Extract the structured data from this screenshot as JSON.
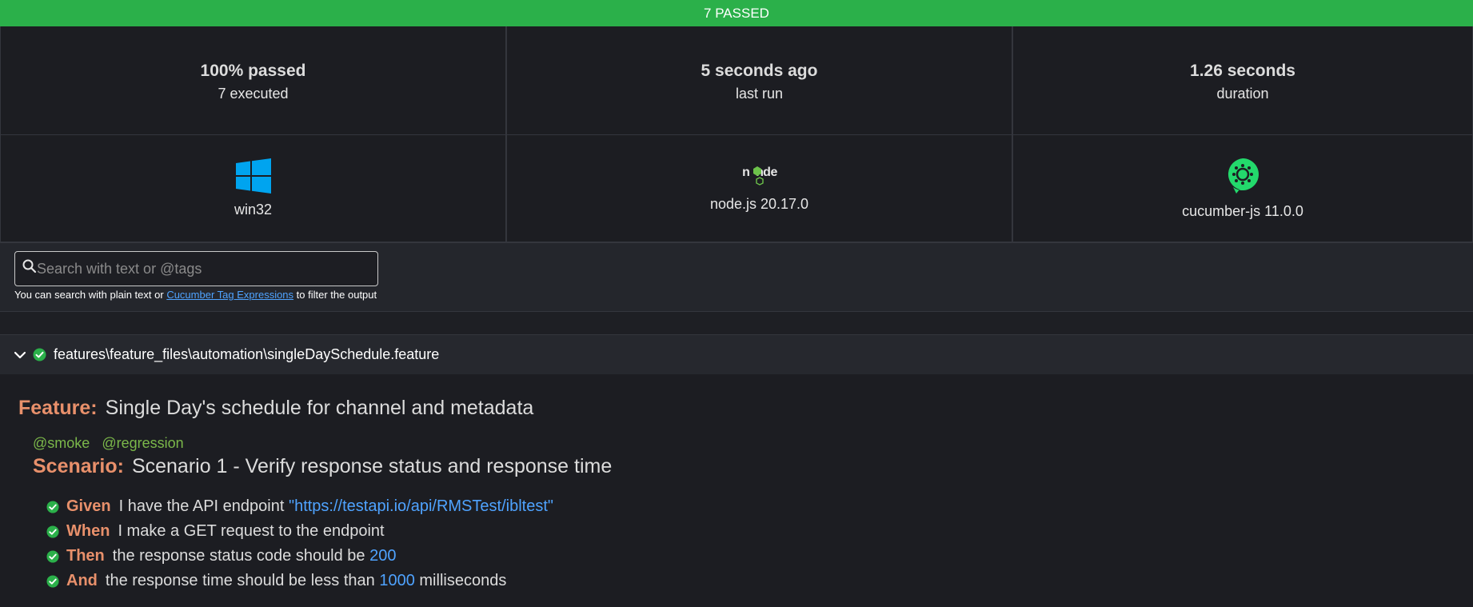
{
  "banner": {
    "text": "7 PASSED",
    "color": "#2bb04a"
  },
  "stats": [
    {
      "value": "100% passed",
      "label": "7 executed"
    },
    {
      "value": "5 seconds ago",
      "label": "last run"
    },
    {
      "value": "1.26 seconds",
      "label": "duration"
    }
  ],
  "env": [
    {
      "icon": "windows-logo-icon",
      "label": "win32"
    },
    {
      "icon": "nodejs-logo-icon",
      "label": "node.js 20.17.0"
    },
    {
      "icon": "cucumber-logo-icon",
      "label": "cucumber-js 11.0.0"
    }
  ],
  "search": {
    "placeholder": "Search with text or @tags",
    "value": "",
    "help_prefix": "You can search with plain text or",
    "help_link": "Cucumber Tag Expressions",
    "help_suffix": "to filter the output"
  },
  "feature": {
    "path": "features\\feature_files\\automation\\singleDaySchedule.feature",
    "keyword": "Feature:",
    "title": "Single Day's schedule for channel and metadata",
    "status": "passed",
    "scenario": {
      "tags": [
        "@smoke",
        "@regression"
      ],
      "keyword": "Scenario:",
      "title": "Scenario 1 - Verify response status and response time",
      "steps": [
        {
          "keyword": "Given",
          "text": "I have the API endpoint",
          "param": "\"https://testapi.io/api/RMSTest/ibltest\"",
          "suffix": ""
        },
        {
          "keyword": "When",
          "text": "I make a GET request to the endpoint",
          "param": "",
          "suffix": ""
        },
        {
          "keyword": "Then",
          "text": "the response status code should be",
          "param": "200",
          "suffix": ""
        },
        {
          "keyword": "And",
          "text": "the response time should be less than",
          "param": "1000",
          "suffix": "milliseconds"
        }
      ]
    }
  },
  "colors": {
    "pass": "#2bb04a",
    "keyword": "#e8906b",
    "tag": "#7bb84a",
    "param": "#4fa3ff"
  }
}
